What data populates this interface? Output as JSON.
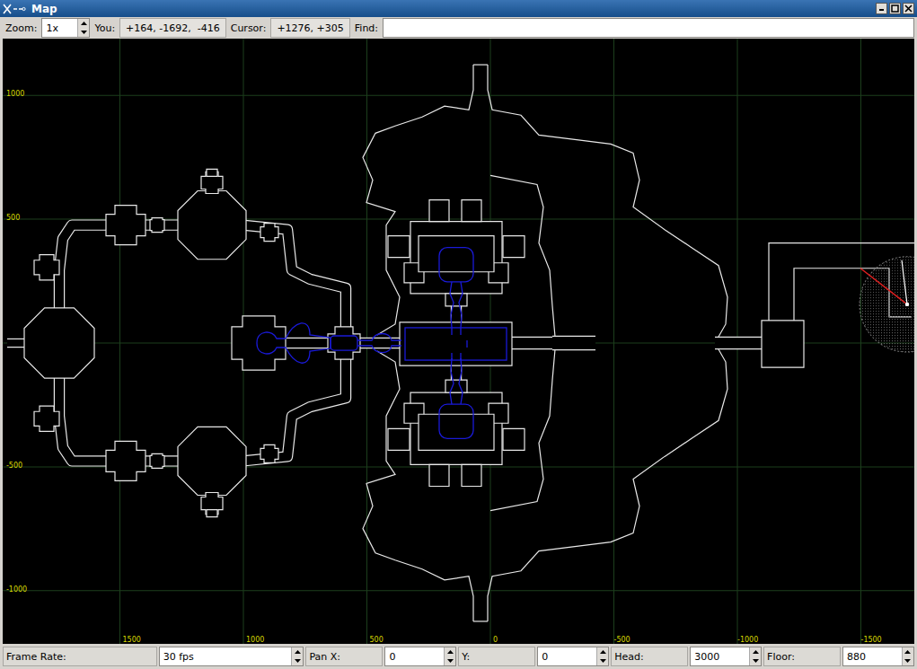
{
  "window": {
    "title": "Map"
  },
  "toolbar": {
    "zoom_label": "Zoom:",
    "zoom": "1x",
    "you_label": "You:",
    "you": "+164, -1692,  -416",
    "cursor_label": "Cursor:",
    "cursor": "+1276, +305",
    "find_label": "Find:"
  },
  "map": {
    "x_ticks": [
      "1500",
      "1000",
      "500",
      "0",
      "-500",
      "-1000",
      "-1500"
    ],
    "y_ticks": [
      "1000",
      "500",
      "-500",
      "-1000"
    ]
  },
  "status_bar": [
    {
      "label": "Frame Rate:",
      "value": "30 fps"
    },
    {
      "label": "Pan X:",
      "value": "0"
    },
    {
      "label": "Y:",
      "value": "0"
    },
    {
      "label": "Head:",
      "value": "3000"
    },
    {
      "label": "Floor:",
      "value": "880"
    }
  ]
}
